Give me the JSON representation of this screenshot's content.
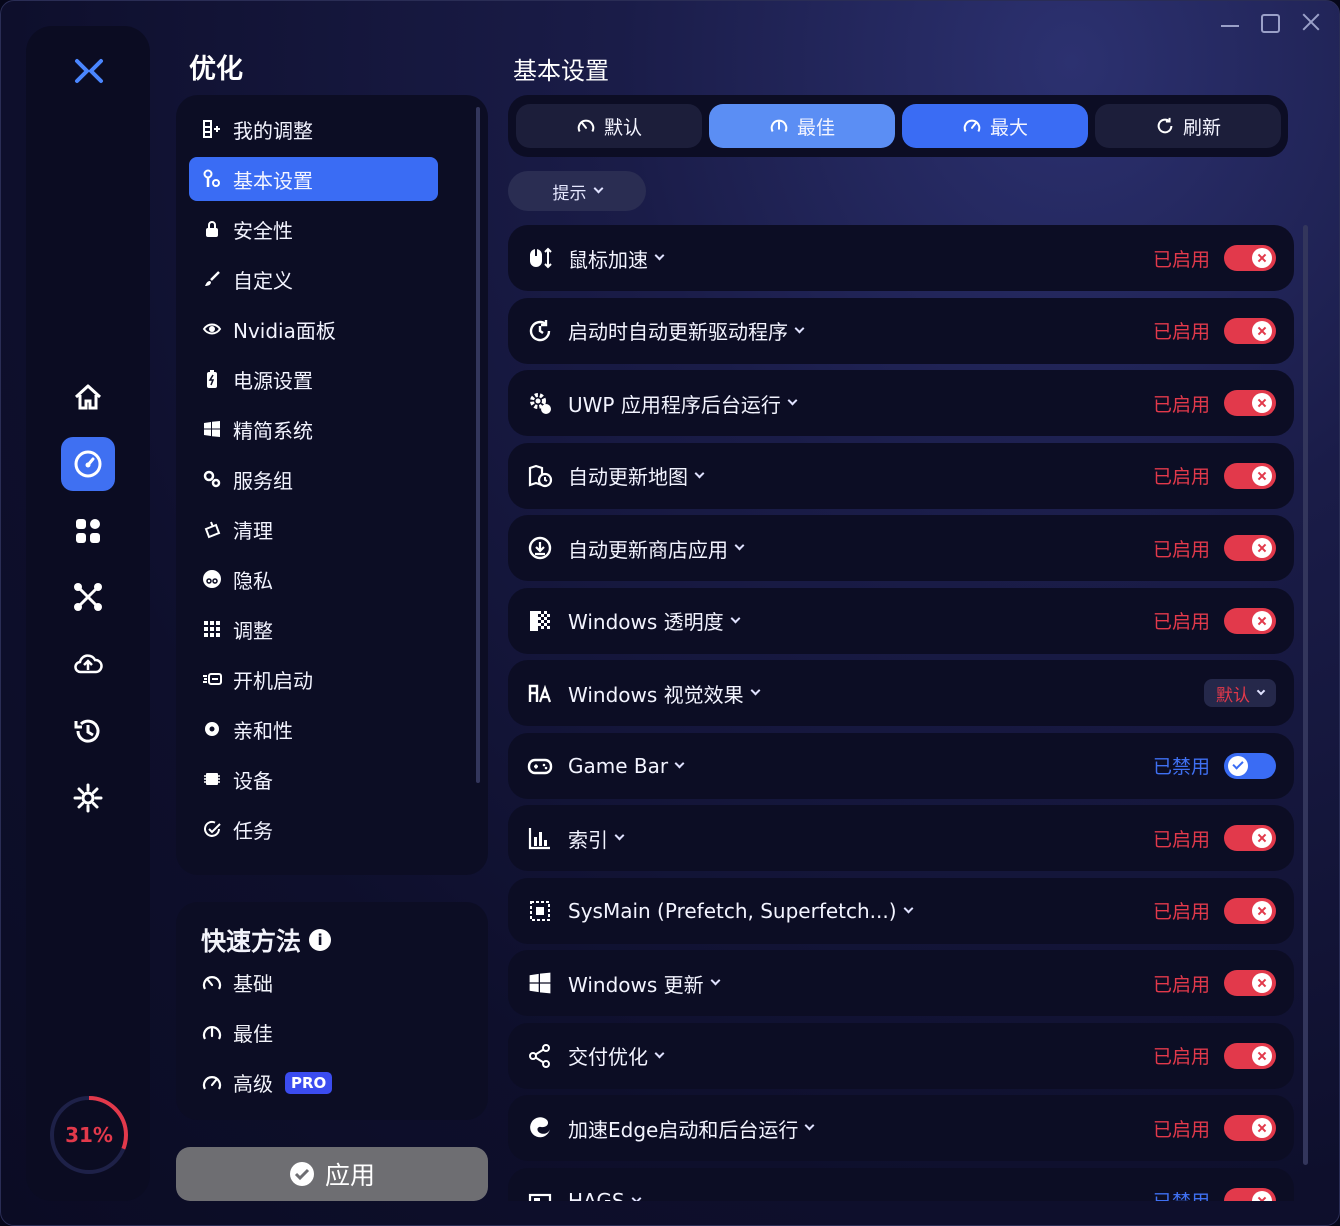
{
  "window": {
    "controls": [
      "minimize",
      "maximize",
      "close"
    ]
  },
  "rail": {
    "items": [
      {
        "name": "home-icon",
        "active": false
      },
      {
        "name": "speedometer-icon",
        "active": true
      },
      {
        "name": "apps-grid-icon",
        "active": false
      },
      {
        "name": "network-icon",
        "active": false
      },
      {
        "name": "cloud-upload-icon",
        "active": false
      },
      {
        "name": "history-icon",
        "active": false
      },
      {
        "name": "settings-gear-icon",
        "active": false
      }
    ],
    "progress": {
      "text": "31%",
      "value": 0.31,
      "color": "#e2394b"
    }
  },
  "sidebar": {
    "title": "优化",
    "items": [
      {
        "label": "我的调整",
        "icon": "list-add-icon",
        "active": false
      },
      {
        "label": "基本设置",
        "icon": "tools-icon",
        "active": true
      },
      {
        "label": "安全性",
        "icon": "lock-icon",
        "active": false
      },
      {
        "label": "自定义",
        "icon": "brush-icon",
        "active": false
      },
      {
        "label": "Nvidia面板",
        "icon": "nvidia-icon",
        "active": false
      },
      {
        "label": "电源设置",
        "icon": "battery-icon",
        "active": false
      },
      {
        "label": "精简系统",
        "icon": "windows-icon",
        "active": false
      },
      {
        "label": "服务组",
        "icon": "gears-icon",
        "active": false
      },
      {
        "label": "清理",
        "icon": "broom-icon",
        "active": false
      },
      {
        "label": "隐私",
        "icon": "incognito-icon",
        "active": false
      },
      {
        "label": "调整",
        "icon": "grid-icon",
        "active": false
      },
      {
        "label": "开机启动",
        "icon": "startup-icon",
        "active": false
      },
      {
        "label": "亲和性",
        "icon": "cpu-gear-icon",
        "active": false
      },
      {
        "label": "设备",
        "icon": "chip-icon",
        "active": false
      },
      {
        "label": "任务",
        "icon": "task-check-icon",
        "active": false
      }
    ]
  },
  "quick": {
    "title": "快速方法",
    "info_icon": "i",
    "items": [
      {
        "label": "基础",
        "icon": "gauge-low-icon"
      },
      {
        "label": "最佳",
        "icon": "gauge-mid-icon"
      },
      {
        "label": "高级",
        "icon": "gauge-high-icon",
        "badge": "PRO"
      }
    ]
  },
  "apply": {
    "label": "应用"
  },
  "main": {
    "title": "基本设置",
    "presets": [
      {
        "label": "默认",
        "icon": "gauge-low-icon",
        "state": "normal"
      },
      {
        "label": "最佳",
        "icon": "gauge-mid-icon",
        "state": "light"
      },
      {
        "label": "最大",
        "icon": "gauge-high-icon",
        "state": "selected"
      },
      {
        "label": "刷新",
        "icon": "refresh-icon",
        "state": "normal"
      }
    ],
    "hint": "提示",
    "settings": [
      {
        "label": "鼠标加速",
        "icon": "mouse-icon",
        "status": "已启用",
        "control": "toggle-on"
      },
      {
        "label": "启动时自动更新驱动程序",
        "icon": "refresh-clock-icon",
        "status": "已启用",
        "control": "toggle-on"
      },
      {
        "label": "UWP 应用程序后台运行",
        "icon": "gear-app-icon",
        "status": "已启用",
        "control": "toggle-on"
      },
      {
        "label": "自动更新地图",
        "icon": "map-clock-icon",
        "status": "已启用",
        "control": "toggle-on"
      },
      {
        "label": "自动更新商店应用",
        "icon": "download-circle-icon",
        "status": "已启用",
        "control": "toggle-on"
      },
      {
        "label": "Windows 透明度",
        "icon": "transparency-icon",
        "status": "已启用",
        "control": "toggle-on"
      },
      {
        "label": "Windows 视觉效果",
        "icon": "font-effect-icon",
        "status": "",
        "control": "dropdown",
        "dropdown_value": "默认"
      },
      {
        "label": "Game Bar",
        "icon": "gamepad-icon",
        "status": "已禁用",
        "control": "toggle-off"
      },
      {
        "label": "索引",
        "icon": "index-chart-icon",
        "status": "已启用",
        "control": "toggle-on"
      },
      {
        "label": "SysMain (Prefetch, Superfetch...)",
        "icon": "sysmain-icon",
        "status": "已启用",
        "control": "toggle-on"
      },
      {
        "label": "Windows 更新",
        "icon": "windows-icon",
        "status": "已启用",
        "control": "toggle-on"
      },
      {
        "label": "交付优化",
        "icon": "share-icon",
        "status": "已启用",
        "control": "toggle-on"
      },
      {
        "label": "加速Edge启动和后台运行",
        "icon": "edge-icon",
        "status": "已启用",
        "control": "toggle-on"
      },
      {
        "label": "HAGS",
        "icon": "gpu-icon",
        "status": "已禁用",
        "control": "toggle-on"
      }
    ]
  },
  "colors": {
    "accent": "#3a6cf4",
    "enabled": "#e2394b",
    "disabled": "#3f70f2"
  }
}
